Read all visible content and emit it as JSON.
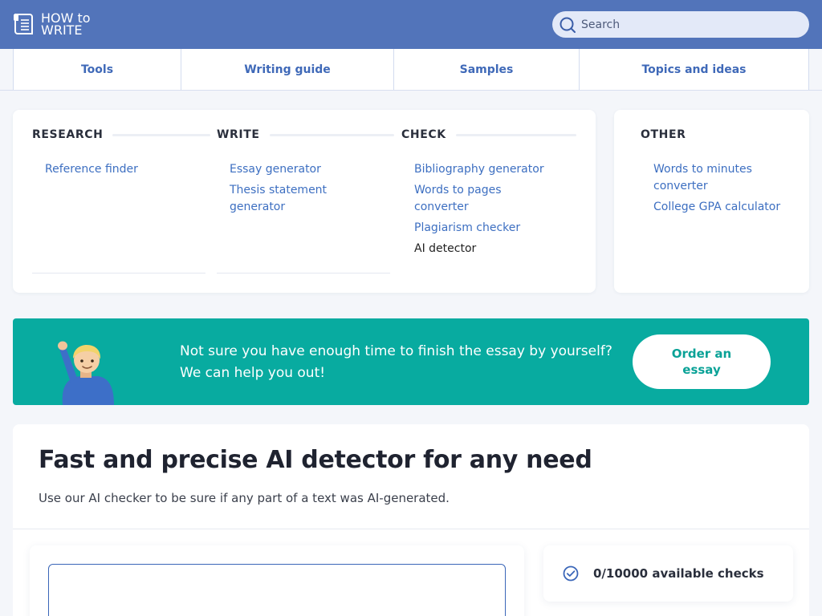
{
  "header": {
    "logo_line1": "HOW to",
    "logo_line2": "WRITE",
    "search_placeholder": "Search",
    "bg_color": "#5274ba"
  },
  "nav": {
    "tabs": [
      {
        "label": "Tools"
      },
      {
        "label": "Writing guide"
      },
      {
        "label": "Samples"
      },
      {
        "label": "Topics and ideas"
      }
    ]
  },
  "tools": {
    "columns": [
      {
        "title": "RESEARCH",
        "links": [
          {
            "label": "Reference finder"
          }
        ]
      },
      {
        "title": "WRITE",
        "links": [
          {
            "label": "Essay generator"
          },
          {
            "label": "Thesis statement generator"
          }
        ]
      },
      {
        "title": "CHECK",
        "links": [
          {
            "label": "Bibliography generator"
          },
          {
            "label": "Words to pages converter"
          },
          {
            "label": "Plagiarism checker"
          },
          {
            "label": "AI detector",
            "current": true
          }
        ]
      },
      {
        "title": "OTHER",
        "links": [
          {
            "label": "Words to minutes converter"
          },
          {
            "label": "College GPA calculator"
          }
        ]
      }
    ],
    "link_color": "#3d6fc1"
  },
  "banner": {
    "line1": "Not sure you have enough time to finish the essay by yourself?",
    "line2": "We can help you out!",
    "button_label": "Order an essay",
    "bg_color": "#08aba0",
    "figure_icon": "waving-person-icon"
  },
  "main": {
    "title": "Fast and precise AI detector for any need",
    "subtitle": "Use our AI checker to be sure if any part of a text was AI-generated.",
    "checks_label": "0/10000 available checks",
    "checks_icon": "check-circle-icon"
  }
}
